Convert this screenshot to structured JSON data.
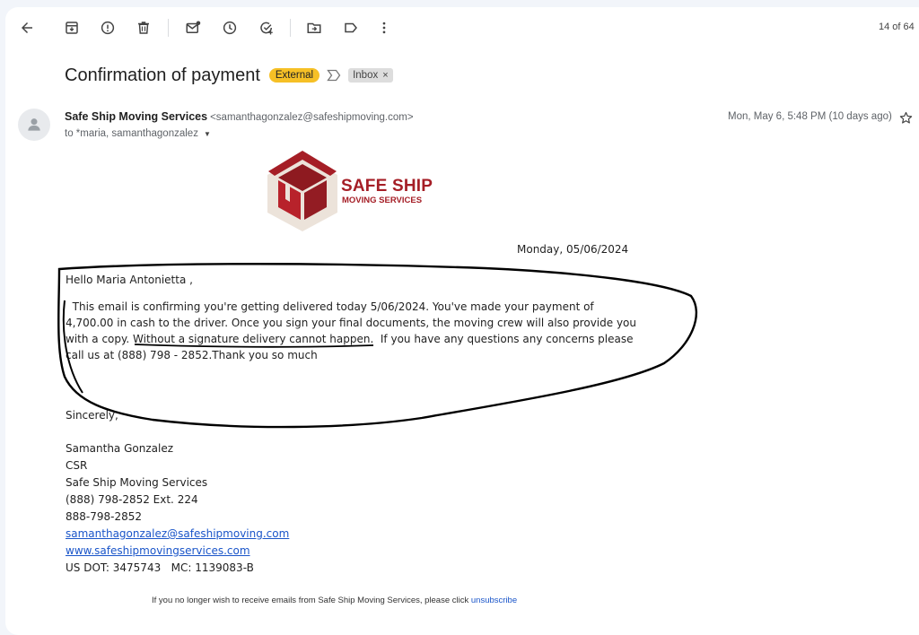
{
  "toolbar": {
    "icons": [
      "back-arrow-icon",
      "archive-icon",
      "report-spam-icon",
      "delete-icon",
      "mark-unread-icon",
      "snooze-icon",
      "add-task-icon",
      "move-to-icon",
      "label-icon",
      "more-options-icon"
    ],
    "counter": "14 of 64"
  },
  "email": {
    "subject": "Confirmation of payment",
    "external_badge": "External",
    "inbox_label": "Inbox",
    "inbox_remove": "×",
    "sender_name": "Safe Ship Moving Services",
    "sender_email": "<samanthagonzalez@safeshipmoving.com>",
    "to_line": "to *maria, samanthagonzalez",
    "date": "Mon, May 6, 5:48 PM (10 days ago)"
  },
  "logo": {
    "line1": "SAFE SHIP",
    "line2": "MOVING SERVICES",
    "color": "#a51e26"
  },
  "message": {
    "date_line": "Monday, 05/06/2024",
    "greeting": "Hello Maria Antonietta ,",
    "paragraph_lines": [
      "  This email is confirming you're getting delivered today 5/06/2024. You've made your payment of",
      "4,700.00 in cash to the driver. Once you sign your final documents, the moving crew will also provide you",
      "with a copy. Without a signature delivery cannot happen.  If you have any questions any concerns please",
      "call us at (888) 798 - 2852.Thank you so much"
    ],
    "closing": "Sincerely,",
    "signature": {
      "name": "Samantha Gonzalez",
      "title": "CSR",
      "company": "Safe Ship Moving Services",
      "phone1": "(888) 798-2852 Ext. 224",
      "phone2": "888-798-2852",
      "email": "samanthagonzalez@safeshipmoving.com",
      "website": "www.safeshipmovingservices.com",
      "dot": "US DOT: 3475743   MC: 1139083-B"
    },
    "footer_text": "If you no longer wish to receive emails from Safe Ship Moving Services, please click ",
    "footer_link": "unsubscribe"
  }
}
